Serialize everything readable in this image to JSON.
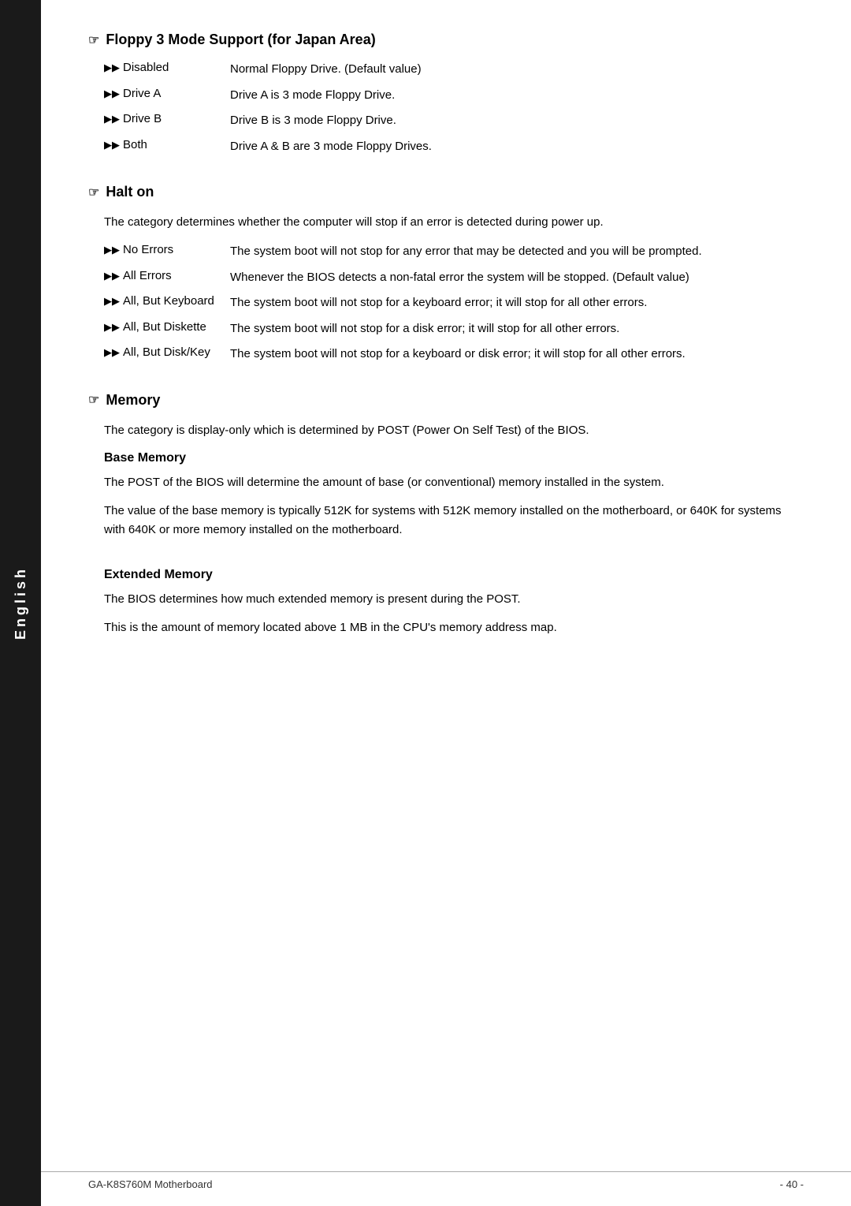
{
  "sidebar": {
    "label": "English"
  },
  "page": {
    "floppy_section": {
      "icon": "☞",
      "title": "Floppy 3 Mode Support (for Japan Area)",
      "options": [
        {
          "key": "Disabled",
          "value": "Normal Floppy Drive. (Default value)"
        },
        {
          "key": "Drive A",
          "value": "Drive A is 3 mode Floppy Drive."
        },
        {
          "key": "Drive B",
          "value": "Drive B is 3 mode Floppy Drive."
        },
        {
          "key": "Both",
          "value": "Drive A & B are 3 mode Floppy Drives."
        }
      ]
    },
    "halt_section": {
      "icon": "☞",
      "title": "Halt on",
      "description": "The category determines whether the computer will stop if an error is detected during power up.",
      "options": [
        {
          "key": "No Errors",
          "value": "The system boot will not stop for any error that may be detected and you will be prompted."
        },
        {
          "key": "All Errors",
          "value": "Whenever the BIOS detects a non-fatal error the system will be stopped. (Default value)"
        },
        {
          "key": "All, But Keyboard",
          "value": "The system boot will not stop for a keyboard error; it will stop for all other errors."
        },
        {
          "key": "All, But Diskette",
          "value": "The system boot will not stop for a disk error; it will stop for all other errors."
        },
        {
          "key": "All, But Disk/Key",
          "value": "The system boot will not stop for a keyboard or disk error; it will stop for all other errors."
        }
      ]
    },
    "memory_section": {
      "icon": "☞",
      "title": "Memory",
      "description": "The category is display-only which is determined by POST (Power On Self Test) of the BIOS.",
      "base_memory": {
        "title": "Base Memory",
        "paragraphs": [
          "The POST of the BIOS will determine the amount of base (or conventional) memory installed in the system.",
          "The value of the base memory is typically 512K for systems with 512K memory installed on the motherboard, or 640K for systems with 640K or more memory installed on the motherboard."
        ]
      },
      "extended_memory": {
        "title": "Extended Memory",
        "paragraphs": [
          "The BIOS determines how much extended memory is present during the POST.",
          "This is the amount of memory located above 1 MB in the CPU's memory address map."
        ]
      }
    },
    "footer": {
      "left": "GA-K8S760M Motherboard",
      "right": "- 40 -"
    }
  }
}
